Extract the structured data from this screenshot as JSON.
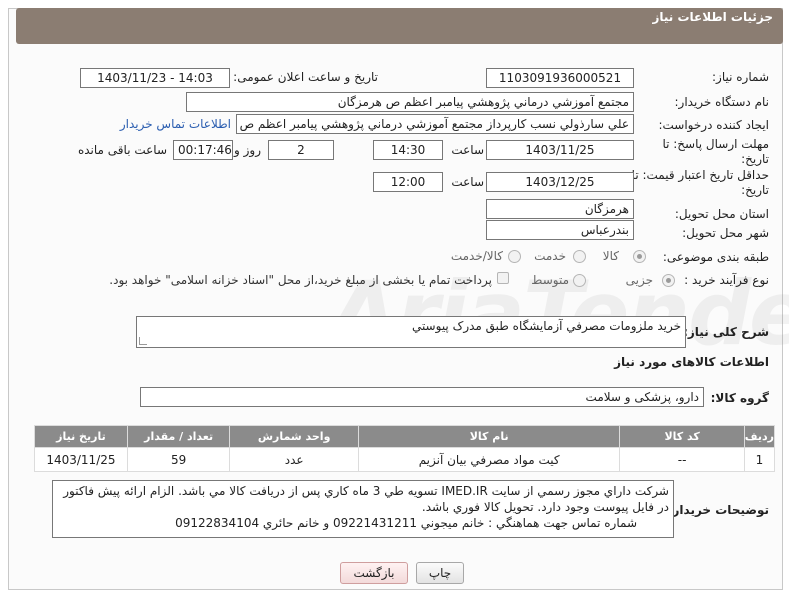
{
  "header": {
    "title": "جزئیات اطلاعات نیاز"
  },
  "form": {
    "need_number": {
      "label": "شماره نیاز:",
      "value": "1103091936000521"
    },
    "announce": {
      "label": "تاریخ و ساعت اعلان عمومی:",
      "value": "1403/11/23 - 14:03"
    },
    "buyer_org": {
      "label": "نام دستگاه خریدار:",
      "value": "مجتمع آموزشي درماني پژوهشي پيامبر اعظم ص  هرمزگان"
    },
    "creator": {
      "label": "ایجاد کننده درخواست:",
      "value": "علي سارذولي نسب كارپرداز مجتمع آموزشي درماني پژوهشي پيامبر اعظم ص",
      "contact_link": "اطلاعات تماس خریدار"
    },
    "reply_deadline": {
      "label_line1": "مهلت ارسال پاسخ: تا",
      "label_line2": "تاریخ:",
      "date": "1403/11/25",
      "time_label": "ساعت",
      "time": "14:30",
      "days": "2",
      "days_label": "روز و",
      "remaining": "00:17:46",
      "remaining_label": "ساعت باقی مانده"
    },
    "price_validity": {
      "label_line1": "حداقل تاریخ اعتبار قیمت: تا",
      "label_line2": "تاریخ:",
      "date": "1403/12/25",
      "time_label": "ساعت",
      "time": "12:00"
    },
    "province": {
      "label": "استان محل تحویل:",
      "value": "هرمزگان"
    },
    "city": {
      "label": "شهر محل تحویل:",
      "value": "بندرعباس"
    },
    "category": {
      "label": "طبقه بندی موضوعی:",
      "options": [
        "کالا",
        "خدمت",
        "کالا/خدمت"
      ],
      "selected": "کالا"
    },
    "purchase_type": {
      "label": "نوع فرآیند خرید :",
      "options": [
        "جزیی",
        "متوسط"
      ],
      "selected": "جزیی",
      "note": "پرداخت تمام یا بخشی از مبلغ خرید،از محل \"اسناد خزانه اسلامی\" خواهد بود."
    }
  },
  "description": {
    "label": "شرح کلی نیاز:",
    "value": "خريد ملزومات مصرفي آزمايشگاه طبق مدرک پيوستي"
  },
  "goods_section": {
    "title": "اطلاعات کالاهای مورد نیاز"
  },
  "goods_group": {
    "label": "گروه کالا:",
    "value": "دارو، پزشکی و سلامت"
  },
  "table": {
    "headers": [
      "ردیف",
      "کد کالا",
      "نام کالا",
      "واحد شمارش",
      "تعداد / مقدار",
      "تاریخ نیاز"
    ],
    "rows": [
      [
        "1",
        "--",
        "كيت مواد مصرفي بيان آنزيم",
        "عدد",
        "59",
        "1403/11/25"
      ]
    ]
  },
  "buyer_notes": {
    "label": "توضیحات خریدار:",
    "line1": "شركت داراي مجوز رسمي از سايت IMED.IR     تسويه طي 3 ماه  كاري پس از دريافت كالا مي باشد.  الزام ارائه پيش فاكتور",
    "line2": "در فايل پيوست وجود دارد.      تحويل كالا فوري باشد.",
    "line3": "شماره تماس جهت هماهنگي : خانم ميجوني 09221431211 و خانم حائري 09122834104"
  },
  "buttons": {
    "print": "چاپ",
    "back": "بازگشت"
  },
  "watermark": "AriaTender.neT"
}
